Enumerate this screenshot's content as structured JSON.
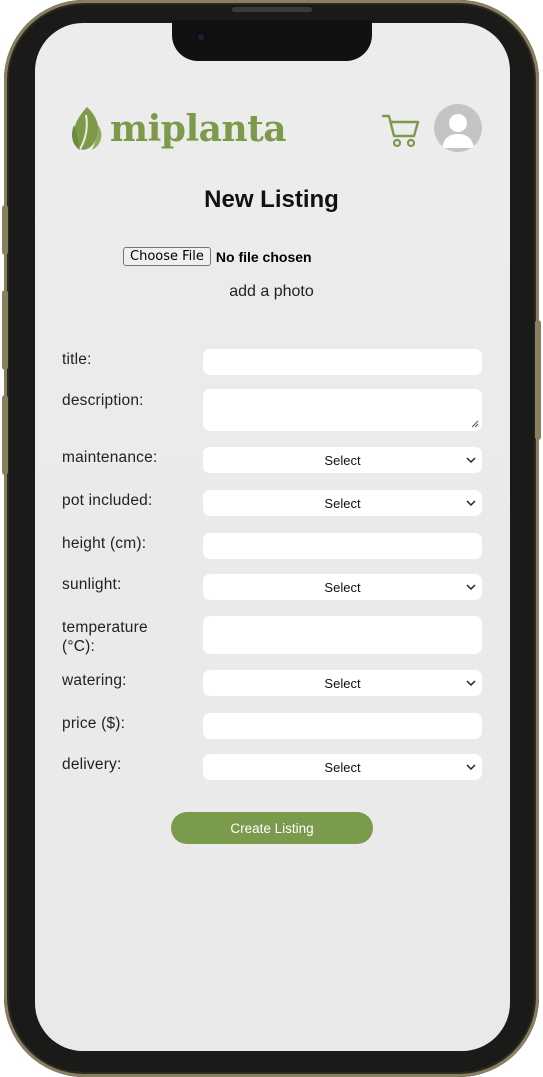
{
  "brand": {
    "name": "miplanta",
    "color": "#7d9a4b"
  },
  "header": {
    "cart_icon": "shopping-cart-icon",
    "avatar_icon": "user-avatar-icon"
  },
  "page": {
    "title": "New Listing"
  },
  "photo": {
    "button_label": "Choose File",
    "status": "No file chosen",
    "hint": "add a photo"
  },
  "form": {
    "title_label": "title:",
    "description_label": "description:",
    "maintenance_label": "maintenance:",
    "maintenance_value": "Select",
    "pot_label": "pot included:",
    "pot_value": "Select",
    "height_label": "height (cm):",
    "sunlight_label": "sunlight:",
    "sunlight_value": "Select",
    "temperature_label_line1": "temperature",
    "temperature_label_line2": "(°C):",
    "watering_label": "watering:",
    "watering_value": "Select",
    "price_label": "price ($):",
    "delivery_label": "delivery:",
    "delivery_value": "Select",
    "submit_label": "Create Listing"
  }
}
